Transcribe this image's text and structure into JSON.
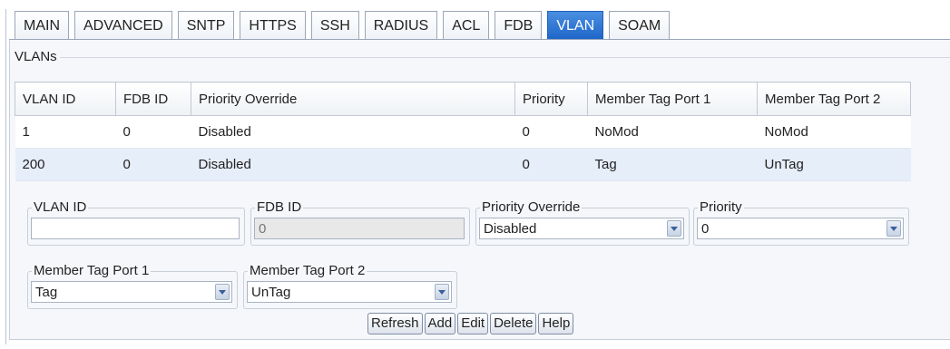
{
  "tabs": [
    {
      "label": "MAIN",
      "active": false
    },
    {
      "label": "ADVANCED",
      "active": false
    },
    {
      "label": "SNTP",
      "active": false
    },
    {
      "label": "HTTPS",
      "active": false
    },
    {
      "label": "SSH",
      "active": false
    },
    {
      "label": "RADIUS",
      "active": false
    },
    {
      "label": "ACL",
      "active": false
    },
    {
      "label": "FDB",
      "active": false
    },
    {
      "label": "VLAN",
      "active": true
    },
    {
      "label": "SOAM",
      "active": false
    }
  ],
  "vlans": {
    "legend": "VLANs",
    "columns": [
      "VLAN ID",
      "FDB ID",
      "Priority Override",
      "Priority",
      "Member Tag Port 1",
      "Member Tag Port 2"
    ],
    "rows": [
      [
        "1",
        "0",
        "Disabled",
        "0",
        "NoMod",
        "NoMod"
      ],
      [
        "200",
        "0",
        "Disabled",
        "0",
        "Tag",
        "UnTag"
      ]
    ]
  },
  "form": {
    "vlan_id": {
      "label": "VLAN ID",
      "value": ""
    },
    "fdb_id": {
      "label": "FDB ID",
      "value": "0"
    },
    "priority_override": {
      "label": "Priority Override",
      "value": "Disabled"
    },
    "priority": {
      "label": "Priority",
      "value": "0"
    },
    "member_tag_port1": {
      "label": "Member Tag Port 1",
      "value": "Tag"
    },
    "member_tag_port2": {
      "label": "Member Tag Port 2",
      "value": "UnTag"
    }
  },
  "buttons": {
    "refresh": "Refresh",
    "add": "Add",
    "edit": "Edit",
    "delete": "Delete",
    "help": "Help"
  },
  "colors": {
    "active_tab": "#1f66c9",
    "selected_row": "#e6eefa"
  }
}
